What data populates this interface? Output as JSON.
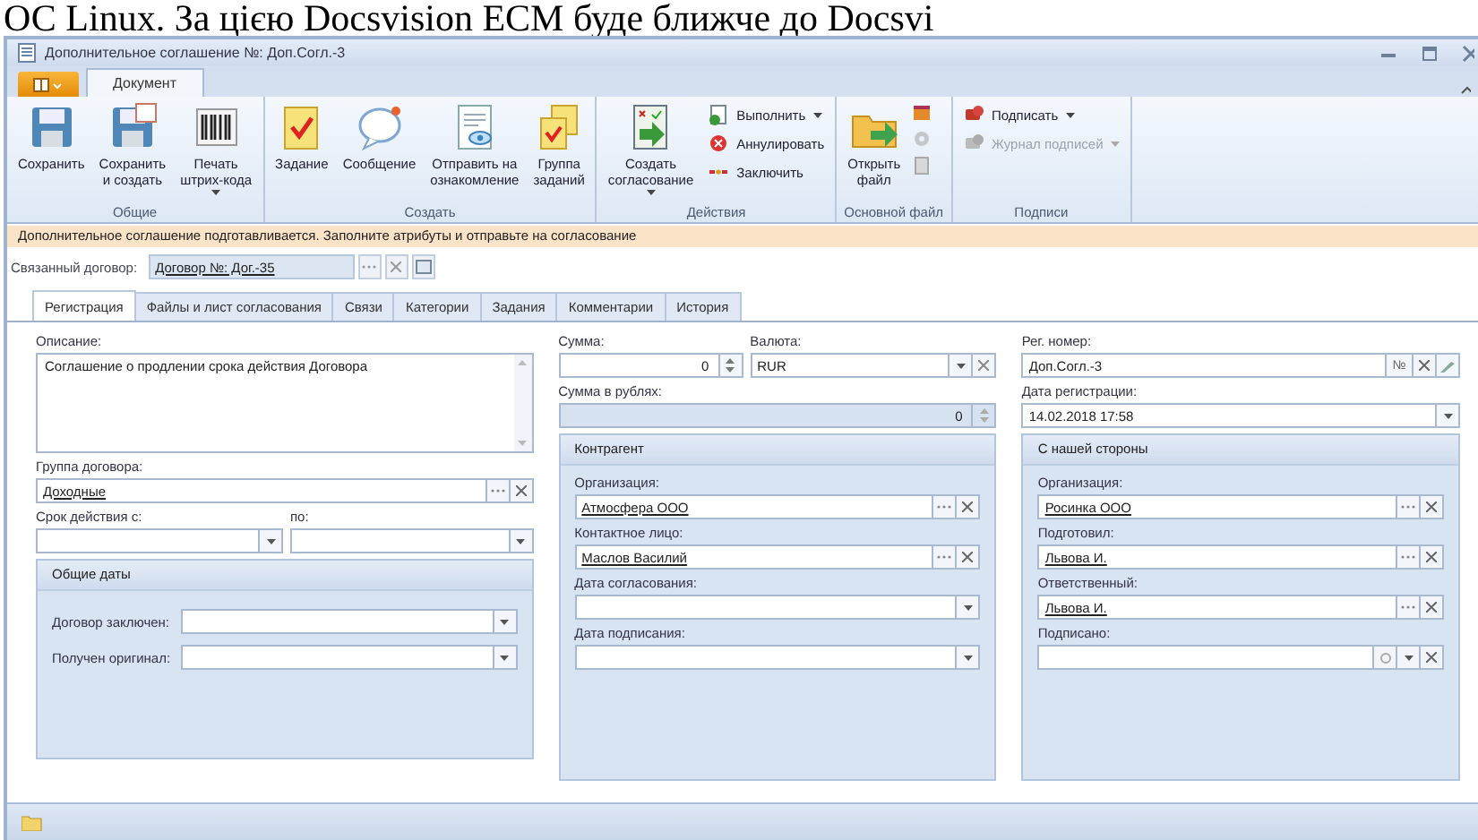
{
  "page_heading": "ОС Linux. За цією Docsvision ECM буде ближче до Docsvi",
  "window": {
    "title": "Дополнительное соглашение №: Доп.Согл.-3"
  },
  "ribbon_tabs": [
    {
      "label": "Документ",
      "selected": true
    }
  ],
  "ribbon_groups": [
    {
      "label": "Общие",
      "items": [
        {
          "kind": "large",
          "label": "Сохранить",
          "dropdown": false,
          "disabled": false
        },
        {
          "kind": "large",
          "label": "Сохранить\nи создать",
          "dropdown": false,
          "disabled": false
        },
        {
          "kind": "large",
          "label": "Печать\nштрих-кода",
          "dropdown": true,
          "disabled": false
        }
      ]
    },
    {
      "label": "Создать",
      "items": [
        {
          "kind": "large",
          "label": "Задание",
          "dropdown": false,
          "disabled": false
        },
        {
          "kind": "large",
          "label": "Сообщение",
          "dropdown": false,
          "disabled": false
        },
        {
          "kind": "large",
          "label": "Отправить на\nознакомление",
          "dropdown": false,
          "disabled": false
        },
        {
          "kind": "large",
          "label": "Группа\nзаданий",
          "dropdown": false,
          "disabled": false
        }
      ]
    },
    {
      "label": "Действия",
      "items": [
        {
          "kind": "large",
          "label": "Создать\nсогласование",
          "dropdown": true,
          "disabled": false
        },
        {
          "kind": "small",
          "label": "Выполнить",
          "dropdown": true,
          "disabled": false
        },
        {
          "kind": "small",
          "label": "Аннулировать",
          "dropdown": false,
          "disabled": false
        },
        {
          "kind": "small",
          "label": "Заключить",
          "dropdown": false,
          "disabled": false
        }
      ]
    },
    {
      "label": "Основной файл",
      "items": [
        {
          "kind": "large",
          "label": "Открыть\nфайл",
          "dropdown": false,
          "disabled": false
        },
        {
          "kind": "icon",
          "disabled": false
        },
        {
          "kind": "icon",
          "disabled": true
        },
        {
          "kind": "icon",
          "disabled": true
        }
      ]
    },
    {
      "label": "Подписи",
      "items": [
        {
          "kind": "small",
          "label": "Подписать",
          "dropdown": true,
          "disabled": false
        },
        {
          "kind": "small",
          "label": "Журнал подписей",
          "dropdown": true,
          "disabled": true
        }
      ]
    }
  ],
  "info_bar": "Дополнительное соглашение подготавливается. Заполните атрибуты и отправьте на согласование",
  "related": {
    "label": "Связанный договор:",
    "value": "Договор №: Дог.-35"
  },
  "form_tabs": [
    {
      "label": "Регистрация",
      "selected": true
    },
    {
      "label": "Файлы и лист согласования",
      "selected": false
    },
    {
      "label": "Связи",
      "selected": false
    },
    {
      "label": "Категории",
      "selected": false
    },
    {
      "label": "Задания",
      "selected": false
    },
    {
      "label": "Комментарии",
      "selected": false
    },
    {
      "label": "История",
      "selected": false
    }
  ],
  "columns": [
    [
      {
        "kind": "memo",
        "label": "Описание:",
        "value": "Соглашение о продлении срока действия Договора"
      },
      {
        "kind": "lookup",
        "label": "Группа договора:",
        "value": "Доходные"
      },
      {
        "kind": "pair",
        "fields": [
          {
            "kind": "date",
            "label": "Срок действия с:"
          },
          {
            "kind": "date",
            "label": "по:"
          }
        ]
      },
      {
        "kind": "inline-group",
        "title": "Общие даты",
        "fields": [
          {
            "kind": "date",
            "label": "Договор заключен:"
          },
          {
            "kind": "date",
            "label": "Получен оригинал:"
          }
        ]
      }
    ],
    [
      {
        "kind": "pair",
        "fields": [
          {
            "kind": "spin",
            "label": "Сумма:",
            "value": "0",
            "disabled": false
          },
          {
            "kind": "combo",
            "label": "Валюта:",
            "value": "RUR"
          }
        ]
      },
      {
        "kind": "spin",
        "label": "Сумма в рублях:",
        "value": "0",
        "disabled": true
      },
      {
        "kind": "group",
        "title": "Контрагент",
        "fields": [
          {
            "kind": "lookup",
            "label": "Организация:",
            "value": "Атмосфера ООО"
          },
          {
            "kind": "lookup",
            "label": "Контактное лицо:",
            "value": "Маслов Василий"
          },
          {
            "kind": "date",
            "label": "Дата согласования:"
          },
          {
            "kind": "date",
            "label": "Дата подписания:"
          }
        ]
      }
    ],
    [
      {
        "kind": "regnum",
        "label": "Рег. номер:",
        "value": "Доп.Согл.-3",
        "button": "№"
      },
      {
        "kind": "date",
        "label": "Дата регистрации:",
        "value": "14.02.2018 17:58"
      },
      {
        "kind": "group",
        "title": "С нашей стороны",
        "fields": [
          {
            "kind": "lookup",
            "label": "Организация:",
            "value": "Росинка ООО"
          },
          {
            "kind": "lookup",
            "label": "Подготовил:",
            "value": "Львова И."
          },
          {
            "kind": "lookup",
            "label": "Ответственный:",
            "value": "Львова И."
          },
          {
            "kind": "signed",
            "label": "Подписано:"
          }
        ]
      }
    ]
  ]
}
